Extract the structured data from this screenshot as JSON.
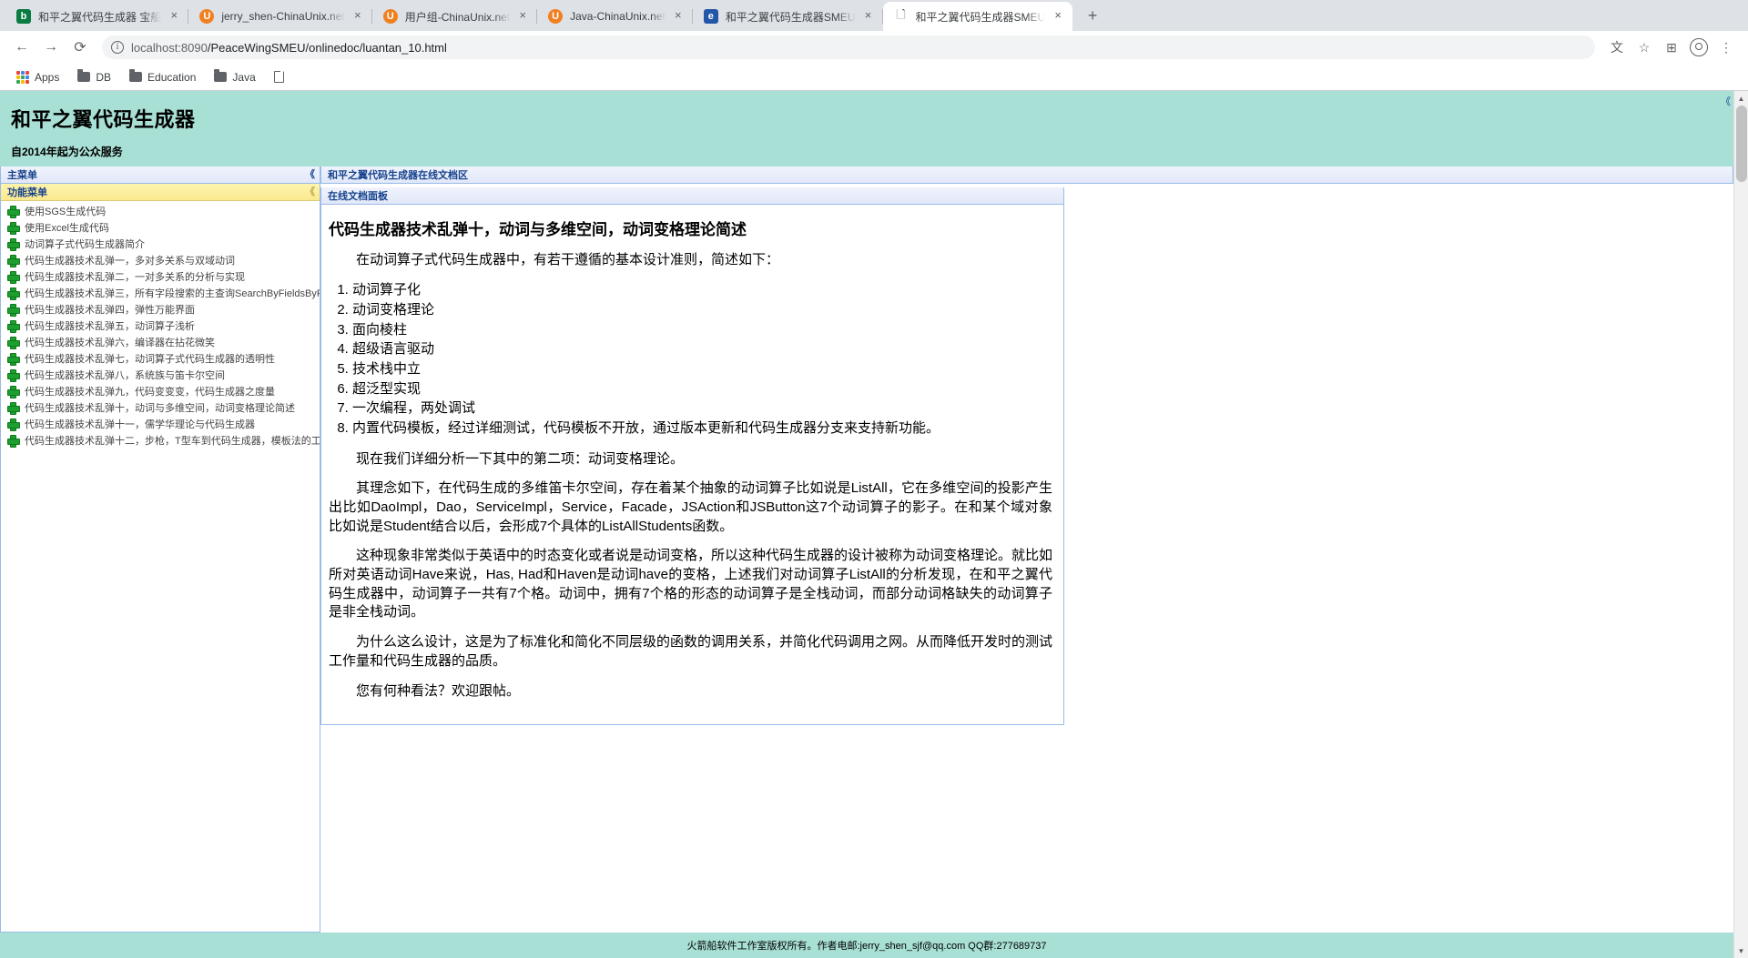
{
  "browser": {
    "tabs": [
      {
        "title": "和平之翼代码生成器 宝船",
        "favicon": "bing-icon",
        "active": false
      },
      {
        "title": "jerry_shen-ChinaUnix.net",
        "favicon": "chinaunix-icon",
        "active": false
      },
      {
        "title": "用户组-ChinaUnix.net",
        "favicon": "chinaunix-icon",
        "active": false
      },
      {
        "title": "Java-ChinaUnix.net",
        "favicon": "chinaunix-icon",
        "active": false
      },
      {
        "title": "和平之翼代码生成器SMEU",
        "favicon": "smeu-icon",
        "active": false
      },
      {
        "title": "和平之翼代码生成器SMEU",
        "favicon": "document-icon",
        "active": true
      }
    ],
    "new_tab_label": "+",
    "close_label": "×",
    "nav": {
      "back": "←",
      "forward": "→",
      "reload": "⟳"
    },
    "omnibox": {
      "info_icon": "i",
      "url_host": "localhost:8090",
      "url_path": "/PeaceWingSMEU/onlinedoc/luantan_10.html"
    },
    "toolbar_icons": [
      {
        "name": "translate-icon",
        "glyph": "文"
      },
      {
        "name": "bookmark-star-icon",
        "glyph": "☆"
      },
      {
        "name": "extensions-icon",
        "glyph": "⊞"
      },
      {
        "name": "profile-avatar-icon",
        "glyph": ""
      },
      {
        "name": "chrome-menu-icon",
        "glyph": "⋮"
      }
    ],
    "bookmarks": [
      {
        "label": "Apps",
        "icon": "apps-grid-icon"
      },
      {
        "label": "DB",
        "icon": "folder-icon"
      },
      {
        "label": "Education",
        "icon": "folder-icon"
      },
      {
        "label": "Java",
        "icon": "folder-icon"
      },
      {
        "label": "",
        "icon": "page-file-icon"
      }
    ]
  },
  "site": {
    "title": "和平之翼代码生成器",
    "subtitle": "自2014年起为公众服务",
    "footer": "火箭船软件工作室版权所有。作者电邮:jerry_shen_sjf@qq.com QQ群:277689737",
    "header_bg": "#a8e0d5"
  },
  "sidebar": {
    "main_menu_title": "主菜单",
    "main_menu_collapse": "《",
    "function_menu_title": "功能菜单",
    "function_menu_collapse": "《",
    "items": [
      {
        "label": "使用SGS生成代码"
      },
      {
        "label": "使用Excel生成代码"
      },
      {
        "label": "动词算子式代码生成器简介"
      },
      {
        "label": "代码生成器技术乱弹一，多对多关系与双域动词"
      },
      {
        "label": "代码生成器技术乱弹二，一对多关系的分析与实现"
      },
      {
        "label": "代码生成器技术乱弹三，所有字段搜索的主查询SearchByFieldsByPage"
      },
      {
        "label": "代码生成器技术乱弹四，弹性万能界面"
      },
      {
        "label": "代码生成器技术乱弹五，动词算子浅析"
      },
      {
        "label": "代码生成器技术乱弹六，编译器在拈花微笑"
      },
      {
        "label": "代码生成器技术乱弹七，动词算子式代码生成器的透明性"
      },
      {
        "label": "代码生成器技术乱弹八，系统族与笛卡尔空间"
      },
      {
        "label": "代码生成器技术乱弹九，代码变变变，代码生成器之度量"
      },
      {
        "label": "代码生成器技术乱弹十，动词与多维空间，动词变格理论简述"
      },
      {
        "label": "代码生成器技术乱弹十一，儒学华理论与代码生成器"
      },
      {
        "label": "代码生成器技术乱弹十二，步枪，T型车到代码生成器，模板法的工业魔术"
      }
    ]
  },
  "content": {
    "region_title": "和平之翼代码生成器在线文档区",
    "panel_title": "在线文档面板",
    "right_collapse": "《",
    "doc": {
      "heading": "代码生成器技术乱弹十，动词与多维空间，动词变格理论简述",
      "intro": "在动词算子式代码生成器中，有若干遵循的基本设计准则，简述如下：",
      "principles": [
        "动词算子化",
        "动词变格理论",
        "面向棱柱",
        "超级语言驱动",
        "技术栈中立",
        "超泛型实现",
        "一次编程，两处调试",
        "内置代码模板，经过详细测试，代码模板不开放，通过版本更新和代码生成器分支来支持新功能。"
      ],
      "paragraphs": [
        "现在我们详细分析一下其中的第二项：动词变格理论。",
        "其理念如下，在代码生成的多维笛卡尔空间，存在着某个抽象的动词算子比如说是ListAll，它在多维空间的投影产生出比如DaoImpl，Dao，ServiceImpl，Service，Facade，JSAction和JSButton这7个动词算子的影子。在和某个域对象比如说是Student结合以后，会形成7个具体的ListAllStudents函数。",
        "这种现象非常类似于英语中的时态变化或者说是动词变格，所以这种代码生成器的设计被称为动词变格理论。就比如所对英语动词Have来说，Has, Had和Haven是动词have的变格，上述我们对动词算子ListAll的分析发现，在和平之翼代码生成器中，动词算子一共有7个格。动词中，拥有7个格的形态的动词算子是全栈动词，而部分动词格缺失的动词算子是非全栈动词。",
        "为什么这么设计，这是为了标准化和简化不同层级的函数的调用关系，并简化代码调用之网。从而降低开发时的测试工作量和代码生成器的品质。",
        "您有何种看法？欢迎跟帖。"
      ]
    }
  }
}
